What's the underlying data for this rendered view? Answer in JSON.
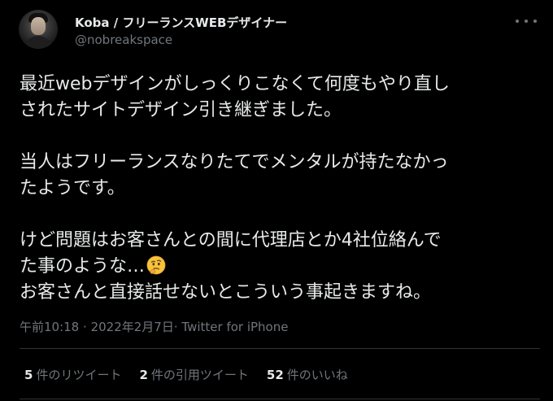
{
  "author": {
    "name": "Koba / フリーランスWEBデザイナー",
    "handle": "@nobreakspace"
  },
  "icons": {
    "more": "more-dots-icon",
    "emoji": "thinking-face-emoji"
  },
  "tweet": {
    "lines": [
      "最近webデザインがしっくりこなくて何度もやり直し",
      "されたサイトデザイン引き継ぎました。",
      "当人はフリーランスなりたてでメンタルが持たなかっ",
      "たようです。",
      "けど問題はお客さんとの間に代理店とか4社位絡んで",
      "た事のような…",
      "お客さんと直接話せないとこういう事起きますね。"
    ]
  },
  "meta": {
    "time": "午前10:18",
    "separator": "·",
    "date": "2022年2月7日",
    "source": "Twitter for iPhone"
  },
  "stats": {
    "retweets": {
      "count": "5",
      "label": "件のリツイート"
    },
    "quotes": {
      "count": "2",
      "label": "件の引用ツイート"
    },
    "likes": {
      "count": "52",
      "label": "件のいいね"
    }
  },
  "colors": {
    "background": "#000000",
    "text": "#e7e9ea",
    "secondary_text": "#71767b",
    "divider": "#2f3336"
  }
}
